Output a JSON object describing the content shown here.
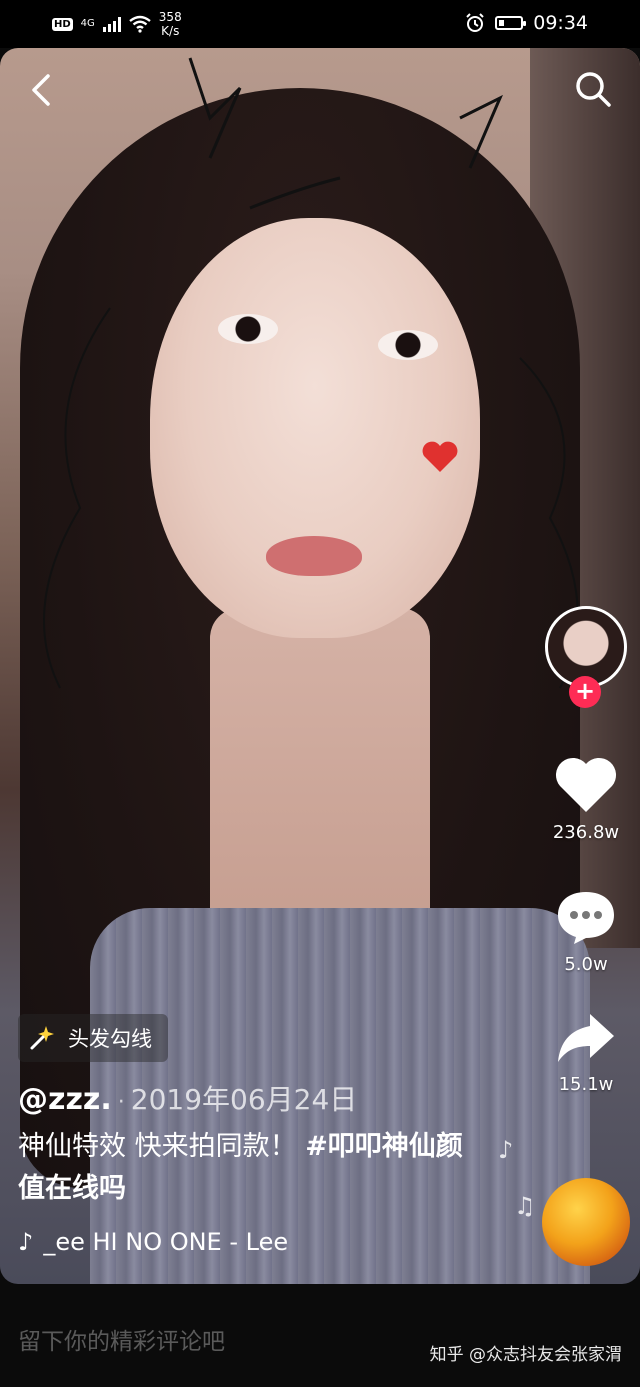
{
  "status_bar": {
    "hd": "HD",
    "network": "4G",
    "speed_value": "358",
    "speed_unit": "K/s",
    "time": "09:34"
  },
  "video": {
    "effect_label": "头发勾线",
    "username": "@zzz.",
    "separator": "·",
    "date": "2019年06月24日",
    "caption_text": "神仙特效  快来拍同款！",
    "caption_tag": "#叩叩神仙颜值在线吗",
    "song_text": "_ee HI     NO ONE - Lee"
  },
  "actions": {
    "likes": "236.8w",
    "comments": "5.0w",
    "shares": "15.1w",
    "follow_symbol": "+"
  },
  "comment_bar": {
    "placeholder": "留下你的精彩评论吧"
  },
  "watermark": "知乎 @众志抖友会张家渭",
  "colors": {
    "accent_red": "#fe2c55",
    "background": "#0b0b0b"
  }
}
